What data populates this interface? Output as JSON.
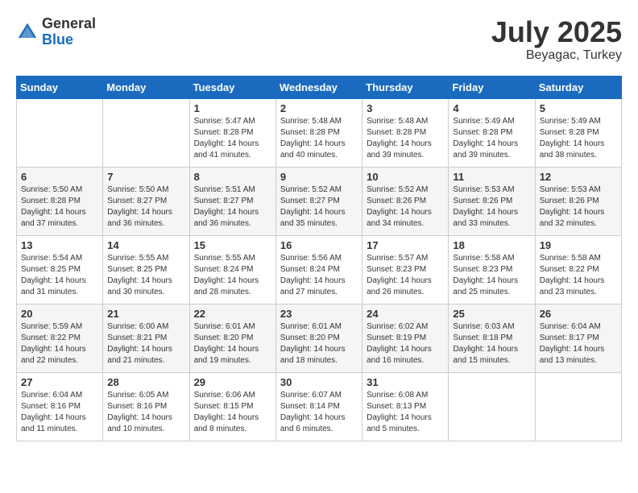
{
  "header": {
    "logo_general": "General",
    "logo_blue": "Blue",
    "month": "July 2025",
    "location": "Beyagac, Turkey"
  },
  "weekdays": [
    "Sunday",
    "Monday",
    "Tuesday",
    "Wednesday",
    "Thursday",
    "Friday",
    "Saturday"
  ],
  "weeks": [
    [
      {
        "day": "",
        "info": ""
      },
      {
        "day": "",
        "info": ""
      },
      {
        "day": "1",
        "info": "Sunrise: 5:47 AM\nSunset: 8:28 PM\nDaylight: 14 hours and 41 minutes."
      },
      {
        "day": "2",
        "info": "Sunrise: 5:48 AM\nSunset: 8:28 PM\nDaylight: 14 hours and 40 minutes."
      },
      {
        "day": "3",
        "info": "Sunrise: 5:48 AM\nSunset: 8:28 PM\nDaylight: 14 hours and 39 minutes."
      },
      {
        "day": "4",
        "info": "Sunrise: 5:49 AM\nSunset: 8:28 PM\nDaylight: 14 hours and 39 minutes."
      },
      {
        "day": "5",
        "info": "Sunrise: 5:49 AM\nSunset: 8:28 PM\nDaylight: 14 hours and 38 minutes."
      }
    ],
    [
      {
        "day": "6",
        "info": "Sunrise: 5:50 AM\nSunset: 8:28 PM\nDaylight: 14 hours and 37 minutes."
      },
      {
        "day": "7",
        "info": "Sunrise: 5:50 AM\nSunset: 8:27 PM\nDaylight: 14 hours and 36 minutes."
      },
      {
        "day": "8",
        "info": "Sunrise: 5:51 AM\nSunset: 8:27 PM\nDaylight: 14 hours and 36 minutes."
      },
      {
        "day": "9",
        "info": "Sunrise: 5:52 AM\nSunset: 8:27 PM\nDaylight: 14 hours and 35 minutes."
      },
      {
        "day": "10",
        "info": "Sunrise: 5:52 AM\nSunset: 8:26 PM\nDaylight: 14 hours and 34 minutes."
      },
      {
        "day": "11",
        "info": "Sunrise: 5:53 AM\nSunset: 8:26 PM\nDaylight: 14 hours and 33 minutes."
      },
      {
        "day": "12",
        "info": "Sunrise: 5:53 AM\nSunset: 8:26 PM\nDaylight: 14 hours and 32 minutes."
      }
    ],
    [
      {
        "day": "13",
        "info": "Sunrise: 5:54 AM\nSunset: 8:25 PM\nDaylight: 14 hours and 31 minutes."
      },
      {
        "day": "14",
        "info": "Sunrise: 5:55 AM\nSunset: 8:25 PM\nDaylight: 14 hours and 30 minutes."
      },
      {
        "day": "15",
        "info": "Sunrise: 5:55 AM\nSunset: 8:24 PM\nDaylight: 14 hours and 28 minutes."
      },
      {
        "day": "16",
        "info": "Sunrise: 5:56 AM\nSunset: 8:24 PM\nDaylight: 14 hours and 27 minutes."
      },
      {
        "day": "17",
        "info": "Sunrise: 5:57 AM\nSunset: 8:23 PM\nDaylight: 14 hours and 26 minutes."
      },
      {
        "day": "18",
        "info": "Sunrise: 5:58 AM\nSunset: 8:23 PM\nDaylight: 14 hours and 25 minutes."
      },
      {
        "day": "19",
        "info": "Sunrise: 5:58 AM\nSunset: 8:22 PM\nDaylight: 14 hours and 23 minutes."
      }
    ],
    [
      {
        "day": "20",
        "info": "Sunrise: 5:59 AM\nSunset: 8:22 PM\nDaylight: 14 hours and 22 minutes."
      },
      {
        "day": "21",
        "info": "Sunrise: 6:00 AM\nSunset: 8:21 PM\nDaylight: 14 hours and 21 minutes."
      },
      {
        "day": "22",
        "info": "Sunrise: 6:01 AM\nSunset: 8:20 PM\nDaylight: 14 hours and 19 minutes."
      },
      {
        "day": "23",
        "info": "Sunrise: 6:01 AM\nSunset: 8:20 PM\nDaylight: 14 hours and 18 minutes."
      },
      {
        "day": "24",
        "info": "Sunrise: 6:02 AM\nSunset: 8:19 PM\nDaylight: 14 hours and 16 minutes."
      },
      {
        "day": "25",
        "info": "Sunrise: 6:03 AM\nSunset: 8:18 PM\nDaylight: 14 hours and 15 minutes."
      },
      {
        "day": "26",
        "info": "Sunrise: 6:04 AM\nSunset: 8:17 PM\nDaylight: 14 hours and 13 minutes."
      }
    ],
    [
      {
        "day": "27",
        "info": "Sunrise: 6:04 AM\nSunset: 8:16 PM\nDaylight: 14 hours and 11 minutes."
      },
      {
        "day": "28",
        "info": "Sunrise: 6:05 AM\nSunset: 8:16 PM\nDaylight: 14 hours and 10 minutes."
      },
      {
        "day": "29",
        "info": "Sunrise: 6:06 AM\nSunset: 8:15 PM\nDaylight: 14 hours and 8 minutes."
      },
      {
        "day": "30",
        "info": "Sunrise: 6:07 AM\nSunset: 8:14 PM\nDaylight: 14 hours and 6 minutes."
      },
      {
        "day": "31",
        "info": "Sunrise: 6:08 AM\nSunset: 8:13 PM\nDaylight: 14 hours and 5 minutes."
      },
      {
        "day": "",
        "info": ""
      },
      {
        "day": "",
        "info": ""
      }
    ]
  ]
}
